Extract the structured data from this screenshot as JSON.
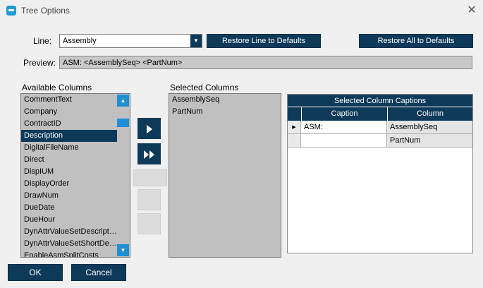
{
  "window": {
    "title": "Tree Options"
  },
  "line": {
    "label": "Line:",
    "value": "Assembly",
    "restore_line_label": "Restore Line to Defaults",
    "restore_all_label": "Restore All to Defaults"
  },
  "preview": {
    "label": "Preview:",
    "value": "ASM: <AssemblySeq> <PartNum>"
  },
  "available": {
    "label": "Available Columns",
    "items": [
      "CommentText",
      "Company",
      "ContractID",
      "Description",
      "DigitalFileName",
      "Direct",
      "DispIUM",
      "DisplayOrder",
      "DrawNum",
      "DueDate",
      "DueHour",
      "DynAttrValueSetDescription",
      "DynAttrValueSetShortDescription",
      "EnableAsmSplitCosts"
    ],
    "selected_item": "Description"
  },
  "selected": {
    "label": "Selected Columns",
    "items": [
      "AssemblySeq",
      "PartNum"
    ]
  },
  "captions_grid": {
    "title": "Selected Column Captions",
    "headers": {
      "caption": "Caption",
      "column": "Column"
    },
    "rows": [
      {
        "caption": "ASM:",
        "column": "AssemblySeq"
      },
      {
        "caption": "",
        "column": "PartNum"
      }
    ]
  },
  "footer": {
    "ok_label": "OK",
    "cancel_label": "Cancel"
  },
  "colors": {
    "accent": "#0e3a5a",
    "scroll_accent": "#1e8fd4",
    "list_bg": "#c0c0c0"
  },
  "icons": {
    "move_one": "play-icon",
    "move_all": "fast-forward-icon",
    "scroll_up": "scroll-up-icon",
    "scroll_down": "scroll-down-icon",
    "dropdown": "dropdown-arrow-icon",
    "close": "close-icon",
    "app": "app-icon",
    "row_pointer": "row-pointer-icon"
  }
}
